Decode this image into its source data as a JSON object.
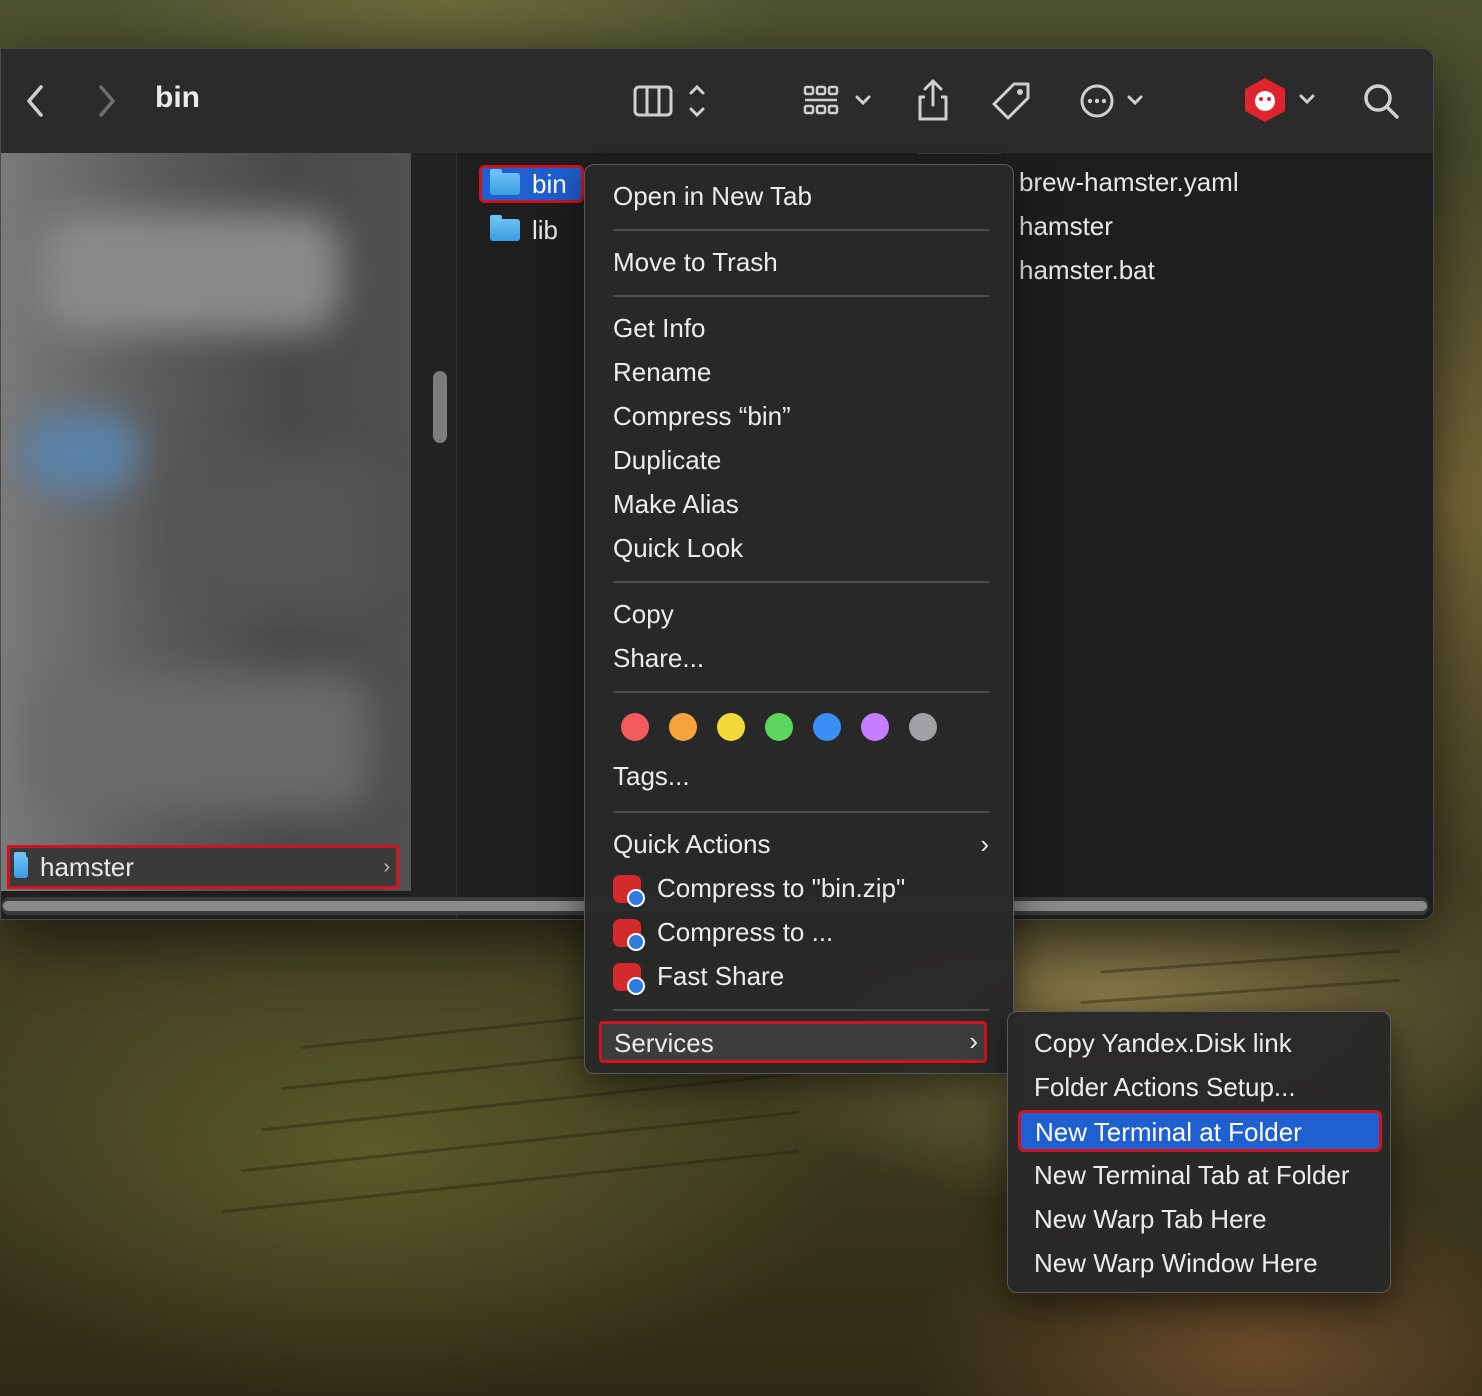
{
  "window": {
    "title": "bin",
    "toolbar": {
      "back_icon": "chevron-left-icon",
      "forward_icon": "chevron-right-icon",
      "view_icon": "column-view-icon",
      "group_icon": "grid-group-icon",
      "share_icon": "share-icon",
      "tag_icon": "tag-icon",
      "action_icon": "ellipsis-circle-icon",
      "app_icon": "hamster-shield-icon",
      "search_icon": "search-icon"
    }
  },
  "sidebar": {
    "selected_label": "hamster"
  },
  "column2": {
    "items": [
      "bin",
      "lib"
    ]
  },
  "column3": {
    "items": [
      "brew-hamster.yaml",
      "hamster",
      "hamster.bat"
    ]
  },
  "context_menu": {
    "open_new_tab": "Open in New Tab",
    "move_to_trash": "Move to Trash",
    "get_info": "Get Info",
    "rename": "Rename",
    "compress": "Compress “bin”",
    "duplicate": "Duplicate",
    "make_alias": "Make Alias",
    "quick_look": "Quick Look",
    "copy": "Copy",
    "share": "Share...",
    "tag_colors": [
      "#f25c5c",
      "#f5a33a",
      "#f5d93a",
      "#5cd65c",
      "#3a8ff5",
      "#c77dff",
      "#a0a0a5"
    ],
    "tags": "Tags...",
    "quick_actions": "Quick Actions",
    "compress_zip": "Compress to \"bin.zip\"",
    "compress_to": "Compress to ...",
    "fast_share": "Fast Share",
    "services": "Services"
  },
  "services_menu": {
    "items": [
      "Copy Yandex.Disk link",
      "Folder Actions Setup...",
      "New Terminal at Folder",
      "New Terminal Tab at Folder",
      "New Warp Tab Here",
      "New Warp Window Here"
    ],
    "highlight_color": "#1f5fd0"
  }
}
